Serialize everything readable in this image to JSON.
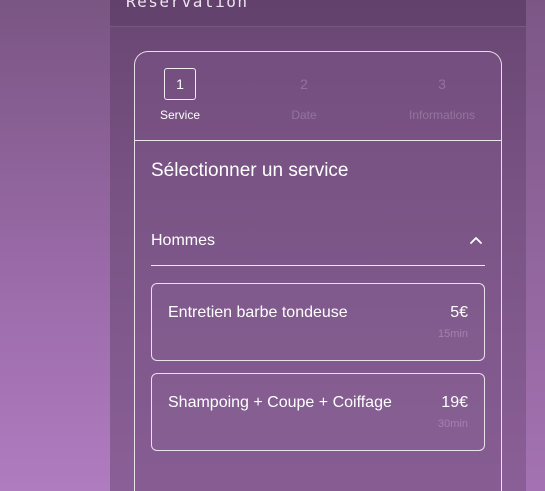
{
  "panel": {
    "title": "Reservation"
  },
  "stepper": {
    "steps": [
      {
        "number": "1",
        "label": "Service",
        "active": true
      },
      {
        "number": "2",
        "label": "Date",
        "active": false
      },
      {
        "number": "3",
        "label": "Informations",
        "active": false
      }
    ]
  },
  "main": {
    "section_title": "Sélectionner un service",
    "category": {
      "label": "Hommes",
      "expanded": true,
      "icon": "chevron-up-icon"
    },
    "services": [
      {
        "name": "Entretien barbe tondeuse",
        "price": "5€",
        "duration": "15min"
      },
      {
        "name": "Shampoing + Coupe + Coiffage",
        "price": "19€",
        "duration": "30min"
      }
    ]
  }
}
